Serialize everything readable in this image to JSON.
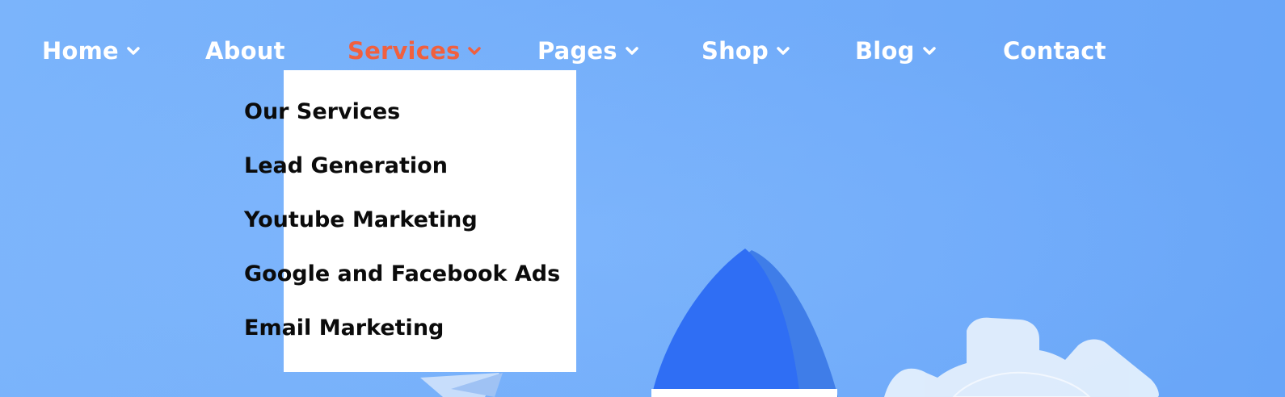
{
  "nav": {
    "items": [
      {
        "label": "Home",
        "has_dropdown": true
      },
      {
        "label": "About",
        "has_dropdown": false
      },
      {
        "label": "Services",
        "has_dropdown": true,
        "active": true
      },
      {
        "label": "Pages",
        "has_dropdown": true
      },
      {
        "label": "Shop",
        "has_dropdown": true
      },
      {
        "label": "Blog",
        "has_dropdown": true
      },
      {
        "label": "Contact",
        "has_dropdown": false
      }
    ]
  },
  "services_menu": {
    "items": [
      {
        "label": "Our Services"
      },
      {
        "label": "Lead Generation"
      },
      {
        "label": "Youtube Marketing"
      },
      {
        "label": "Google and Facebook Ads"
      },
      {
        "label": "Email Marketing"
      }
    ]
  },
  "icons": {
    "chevron": "chevron-down-icon",
    "hero": [
      "rocket-icon",
      "gear-icon",
      "paper-plane-icon"
    ]
  },
  "colors": {
    "background": "#74aefa",
    "nav_text": "#ffffff",
    "active": "#f0603f",
    "dropdown_bg": "#ffffff",
    "dropdown_text": "#0b0b0b",
    "rocket": "#2f6ef4"
  }
}
